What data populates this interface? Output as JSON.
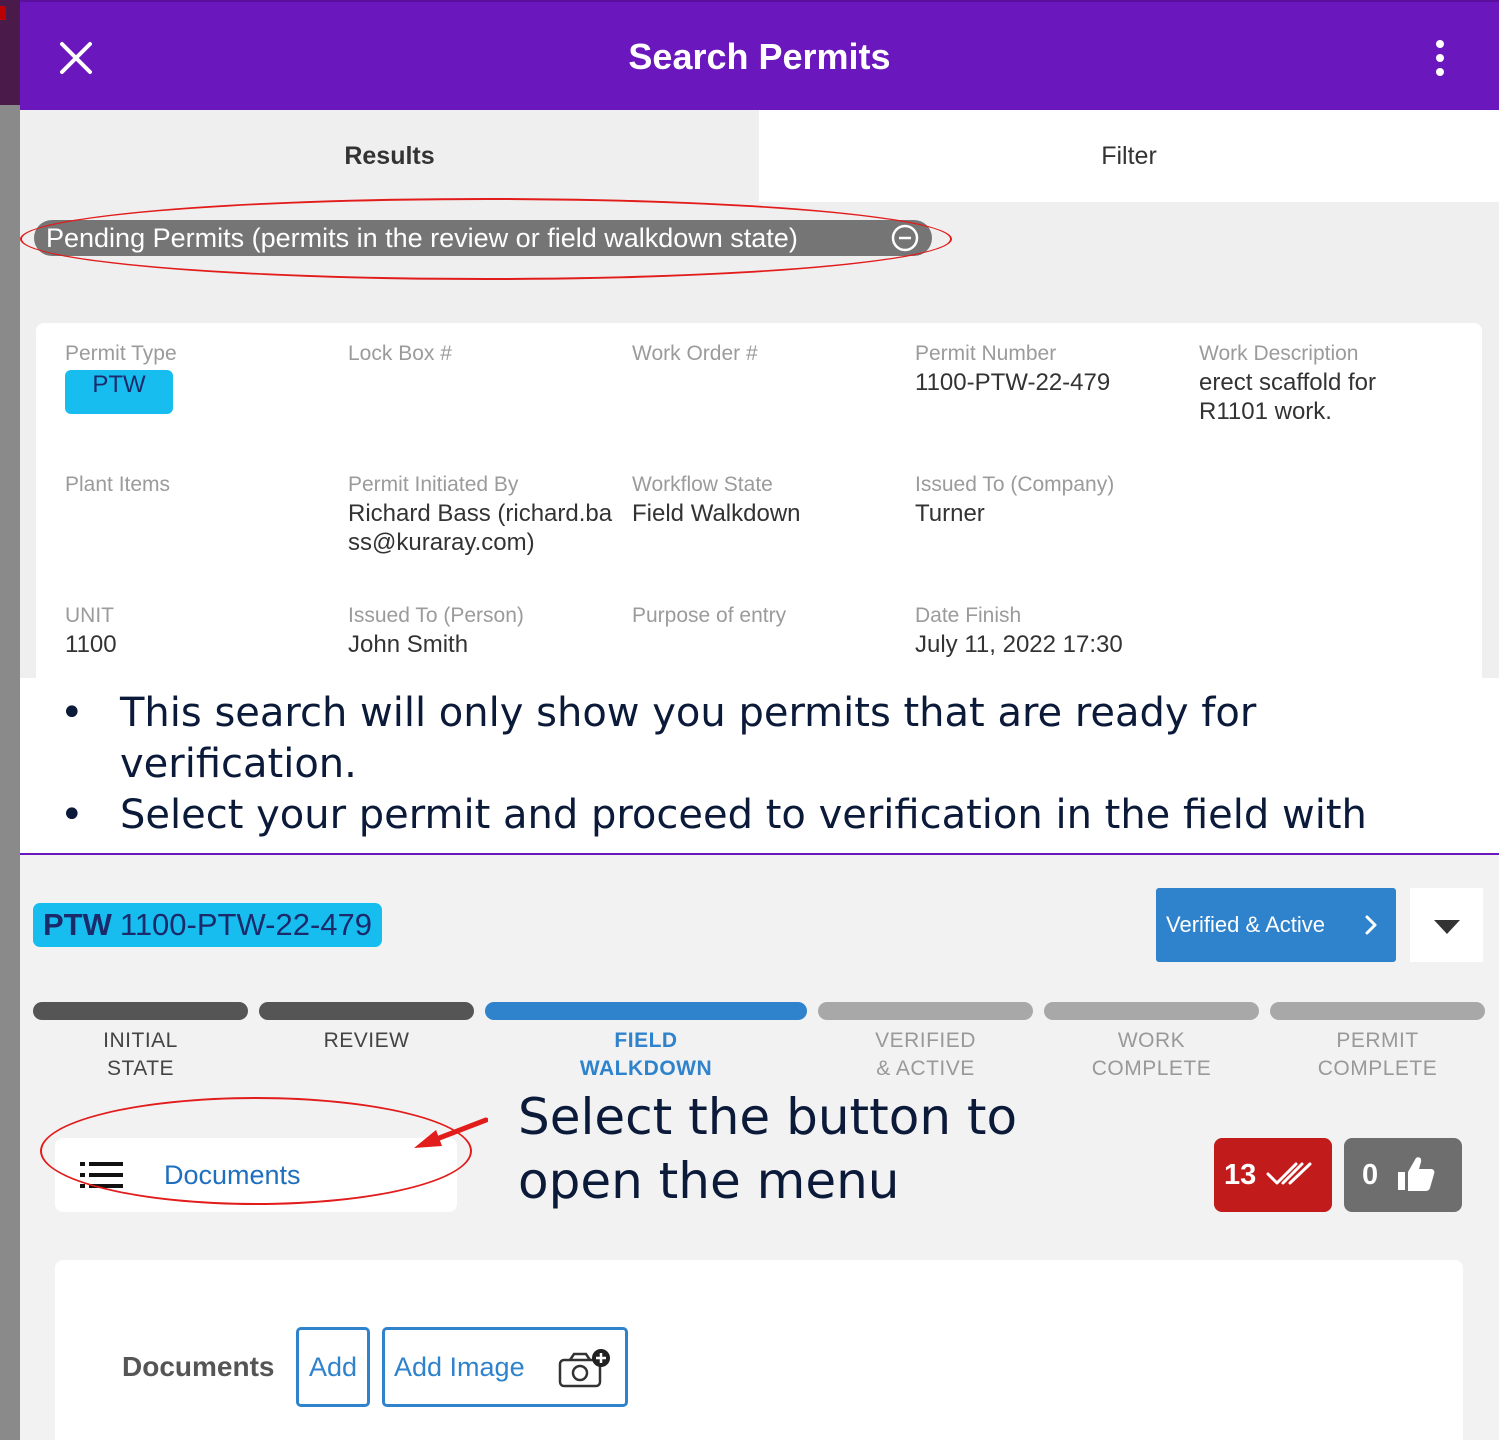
{
  "top": {
    "appbar": {
      "title": "Search Permits",
      "close_icon": "close-icon",
      "menu_icon": "more-vertical-icon",
      "color": "#6a17bd"
    },
    "tabs": [
      {
        "label": "Results"
      },
      {
        "label": "Filter"
      }
    ],
    "filter_chip": "Pending Permits (permits in the review or field walkdown state)",
    "result": {
      "permit_type": {
        "label": "Permit Type",
        "value": "PTW"
      },
      "lock_box": {
        "label": "Lock Box #",
        "value": ""
      },
      "work_order": {
        "label": "Work Order #",
        "value": ""
      },
      "permit_number": {
        "label": "Permit Number",
        "value": "1100-PTW-22-479"
      },
      "work_description": {
        "label": "Work Description",
        "value": "erect scaffold for R1101 work."
      },
      "plant_items": {
        "label": "Plant Items",
        "value": ""
      },
      "initiated_by": {
        "label": "Permit Initiated By",
        "value": "Richard Bass (richard.bass@kuraray.com)"
      },
      "workflow_state": {
        "label": "Workflow State",
        "value": "Field Walkdown"
      },
      "issued_company": {
        "label": "Issued To (Company)",
        "value": "Turner"
      },
      "unit": {
        "label": "UNIT",
        "value": "1100"
      },
      "issued_person": {
        "label": "Issued To (Person)",
        "value": "John Smith"
      },
      "purpose": {
        "label": "Purpose of entry",
        "value": ""
      },
      "date_finish": {
        "label": "Date Finish",
        "value": "July 11, 2022 17:30"
      }
    }
  },
  "slide": {
    "bullets": [
      "This search will only show you permits that are ready for verification.",
      "Select your permit and proceed to verification in the field with"
    ],
    "callout": "Select the button to open the menu"
  },
  "bottom": {
    "permit": {
      "type": "PTW",
      "number": "1100-PTW-22-479"
    },
    "status_button": "Verified & Active",
    "steps": [
      {
        "label1": "INITIAL",
        "label2": "STATE",
        "state": "done"
      },
      {
        "label1": "REVIEW",
        "label2": "",
        "state": "done"
      },
      {
        "label1": "FIELD",
        "label2": "WALKDOWN",
        "state": "current"
      },
      {
        "label1": "VERIFIED",
        "label2": "& ACTIVE",
        "state": "todo"
      },
      {
        "label1": "WORK",
        "label2": "COMPLETE",
        "state": "todo"
      },
      {
        "label1": "PERMIT",
        "label2": "COMPLETE",
        "state": "todo"
      }
    ],
    "documents_button": "Documents",
    "counters": {
      "verifications": "13",
      "approvals": "0"
    },
    "documents_card": {
      "heading": "Documents",
      "add": "Add",
      "add_image": "Add Image"
    },
    "colors": {
      "done": "#555555",
      "current": "#2f82cc",
      "todo": "#a8a8a8",
      "annotation": "#e21b1b"
    }
  }
}
